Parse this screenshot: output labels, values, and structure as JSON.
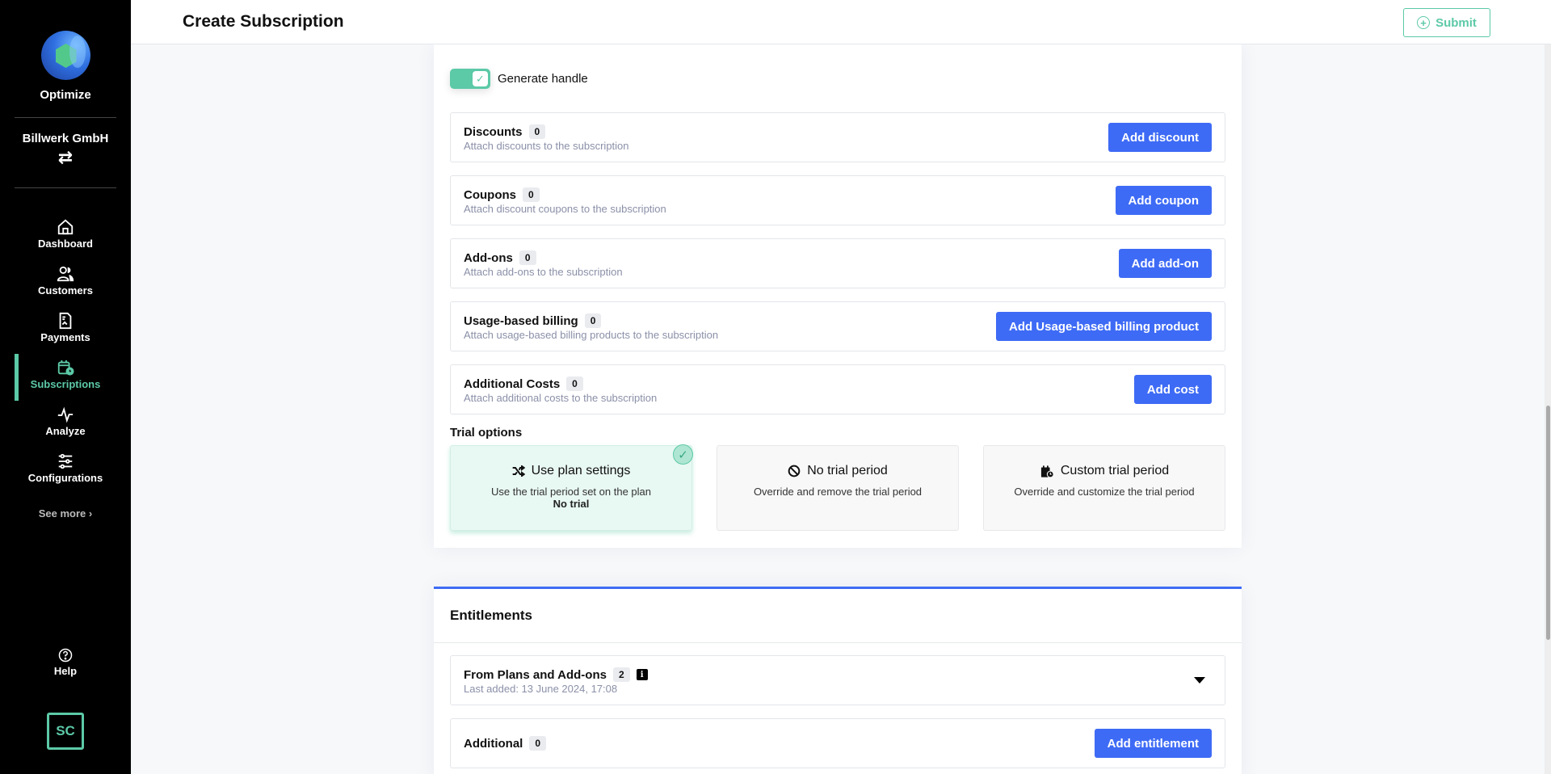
{
  "sidebar": {
    "brand": "Optimize",
    "organization": "Billwerk GmbH",
    "switch_icon": "swap-arrows-icon",
    "items": [
      {
        "label": "Dashboard",
        "icon": "home-icon",
        "active": false
      },
      {
        "label": "Customers",
        "icon": "users-icon",
        "active": false
      },
      {
        "label": "Payments",
        "icon": "document-icon",
        "active": false
      },
      {
        "label": "Subscriptions",
        "icon": "calendar-clock-icon",
        "active": true
      },
      {
        "label": "Analyze",
        "icon": "pulse-icon",
        "active": false
      },
      {
        "label": "Configurations",
        "icon": "sliders-icon",
        "active": false
      }
    ],
    "see_more": "See more",
    "help": "Help",
    "user_initials": "SC",
    "accent_color": "#5cc9a7"
  },
  "header": {
    "title": "Create Subscription",
    "submit_label": "Submit"
  },
  "form": {
    "generate_handle": {
      "label": "Generate handle",
      "checked": true
    },
    "rows": [
      {
        "title": "Discounts",
        "count": "0",
        "subtitle": "Attach discounts to the subscription",
        "button": "Add discount"
      },
      {
        "title": "Coupons",
        "count": "0",
        "subtitle": "Attach discount coupons to the subscription",
        "button": "Add coupon"
      },
      {
        "title": "Add-ons",
        "count": "0",
        "subtitle": "Attach add-ons to the subscription",
        "button": "Add add-on"
      },
      {
        "title": "Usage-based billing",
        "count": "0",
        "subtitle": "Attach usage-based billing products to the subscription",
        "button": "Add Usage-based billing product"
      },
      {
        "title": "Additional Costs",
        "count": "0",
        "subtitle": "Attach additional costs to the subscription",
        "button": "Add cost"
      }
    ],
    "trial_options": {
      "label": "Trial options",
      "options": [
        {
          "title": "Use plan settings",
          "icon": "shuffle-icon",
          "description": "Use the trial period set on the plan",
          "detail": "No trial",
          "selected": true
        },
        {
          "title": "No trial period",
          "icon": "ban-icon",
          "description": "Override and remove the trial period",
          "detail": "",
          "selected": false
        },
        {
          "title": "Custom trial period",
          "icon": "calendar-clock-icon",
          "description": "Override and customize the trial period",
          "detail": "",
          "selected": false
        }
      ]
    }
  },
  "entitlements": {
    "title": "Entitlements",
    "from_plans": {
      "title": "From Plans and Add-ons",
      "count": "2",
      "subtitle": "Last added: 13 June 2024, 17:08"
    },
    "additional": {
      "title": "Additional",
      "count": "0",
      "button": "Add entitlement"
    }
  },
  "colors": {
    "primary_blue": "#3e6bf5",
    "accent_green": "#5cc9a7"
  }
}
